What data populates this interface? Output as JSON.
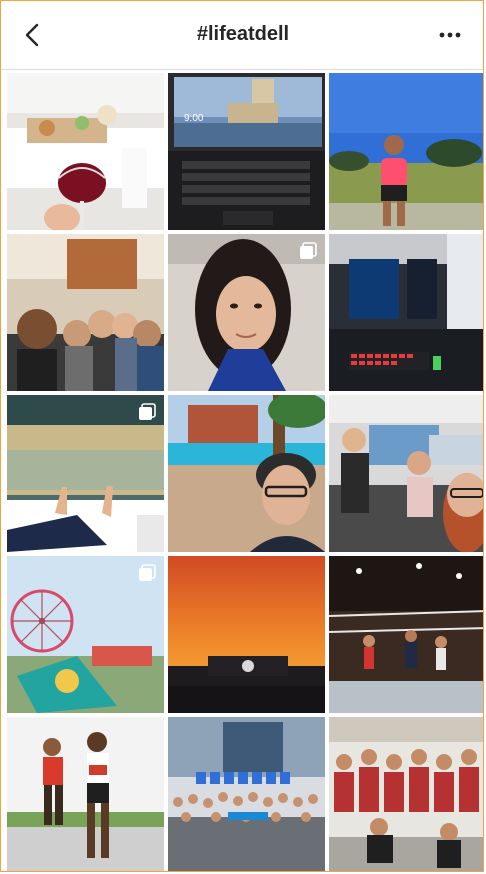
{
  "header": {
    "title": "#lifeatdell",
    "back_icon": "chevron-left-icon",
    "more_icon": "more-horizontal-icon"
  },
  "grid": {
    "posts": [
      {
        "subject": "wine-table-party",
        "multi": false
      },
      {
        "subject": "laptop-castle-wallpaper",
        "multi": false,
        "screen_time": "9:00"
      },
      {
        "subject": "woman-sports-park",
        "multi": false
      },
      {
        "subject": "group-selfie-office",
        "multi": false
      },
      {
        "subject": "woman-selfie",
        "multi": true
      },
      {
        "subject": "gaming-pc-setup",
        "multi": false
      },
      {
        "subject": "pool-feet-relax",
        "multi": true
      },
      {
        "subject": "man-selfie-resort",
        "multi": false
      },
      {
        "subject": "office-coworkers",
        "multi": false
      },
      {
        "subject": "ferris-wheel-carnival",
        "multi": true
      },
      {
        "subject": "sunset-sky-dell-building",
        "multi": false
      },
      {
        "subject": "volleyball-court",
        "multi": false
      },
      {
        "subject": "marathon-runners",
        "multi": false
      },
      {
        "subject": "grad-day-group",
        "multi": false
      },
      {
        "subject": "team-medals-photo",
        "multi": false
      }
    ]
  },
  "colors": {
    "frame_border": "#f0a640",
    "header_divider": "#dbdbdb",
    "text": "#262626"
  }
}
